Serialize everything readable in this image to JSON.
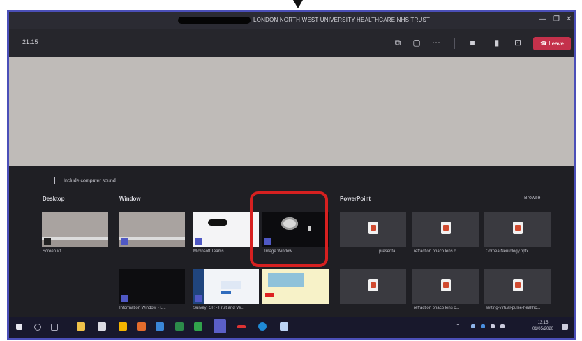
{
  "window": {
    "title": "LONDON NORTH WEST UNIVERSITY HEALTHCARE NHS TRUST",
    "controls": [
      "—",
      "❐",
      "✕"
    ]
  },
  "toolbar": {
    "timer": "21:15",
    "icons": [
      "participants-icon",
      "chat-icon",
      "more-icon",
      "camera-icon",
      "mic-icon",
      "share-icon"
    ],
    "leave_label": "Leave"
  },
  "share_tray": {
    "include_audio": "Include computer sound",
    "sections": {
      "desktop": "Desktop",
      "window": "Window",
      "powerpoint": "PowerPoint"
    },
    "browse_label": "Browse",
    "desktop_items": [
      {
        "caption": "Screen #1"
      }
    ],
    "window_items": [
      {
        "caption": ""
      },
      {
        "caption": "Microsoft Teams"
      },
      {
        "caption": "Image Window"
      },
      {
        "caption": "Information Window - L..."
      },
      {
        "caption": "SurveyFSR - Fruit and Ve..."
      },
      {
        "caption": ""
      }
    ],
    "powerpoint_items": [
      {
        "caption": "presenta..."
      },
      {
        "caption": "refraction phaco lens c..."
      },
      {
        "caption": "Cornea Neurology.pptx"
      },
      {
        "caption": ""
      },
      {
        "caption": "refraction phaco lens c..."
      },
      {
        "caption": "setting-virtual-pulse-healthc..."
      }
    ]
  },
  "taskbar": {
    "time": "13:15",
    "date": "01/05/2020"
  }
}
